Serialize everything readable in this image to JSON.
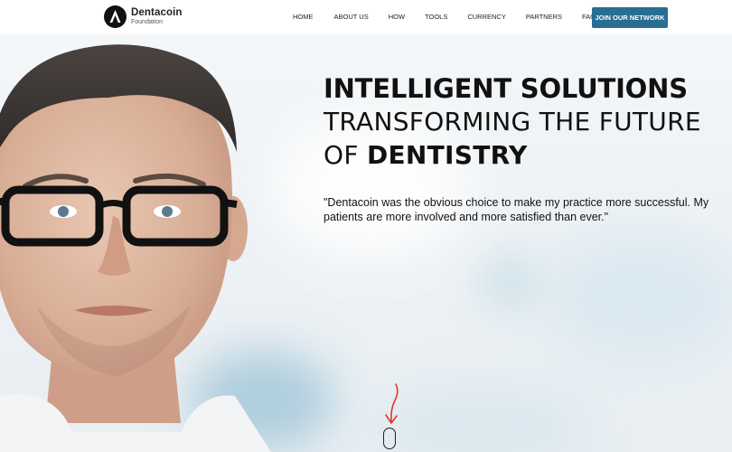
{
  "brand": {
    "name": "Dentacoin",
    "subtitle": "Foundation"
  },
  "nav": {
    "items": [
      {
        "label": "HOME"
      },
      {
        "label": "ABOUT US"
      },
      {
        "label": "HOW"
      },
      {
        "label": "TOOLS"
      },
      {
        "label": "CURRENCY"
      },
      {
        "label": "PARTNERS"
      },
      {
        "label": "FAQ"
      }
    ],
    "cta_label": "JOIN OUR NETWORK"
  },
  "hero": {
    "title_line1": "INTELLIGENT SOLUTIONS",
    "title_line2": "TRANSFORMING THE FUTURE",
    "title_line3_prefix": "OF ",
    "title_line3_bold": "DENTISTRY",
    "quote": "\"Dentacoin was the obvious choice to make my practice more successful.  My patients are more involved and more satisfied than ever.\""
  },
  "colors": {
    "cta": "#2a6d93",
    "annotation_arrow": "#e0362b"
  },
  "icons": {
    "logo": "dentacoin-logo-icon",
    "scroll": "mouse-scroll-icon",
    "arrow": "red-arrow-annotation-icon"
  }
}
